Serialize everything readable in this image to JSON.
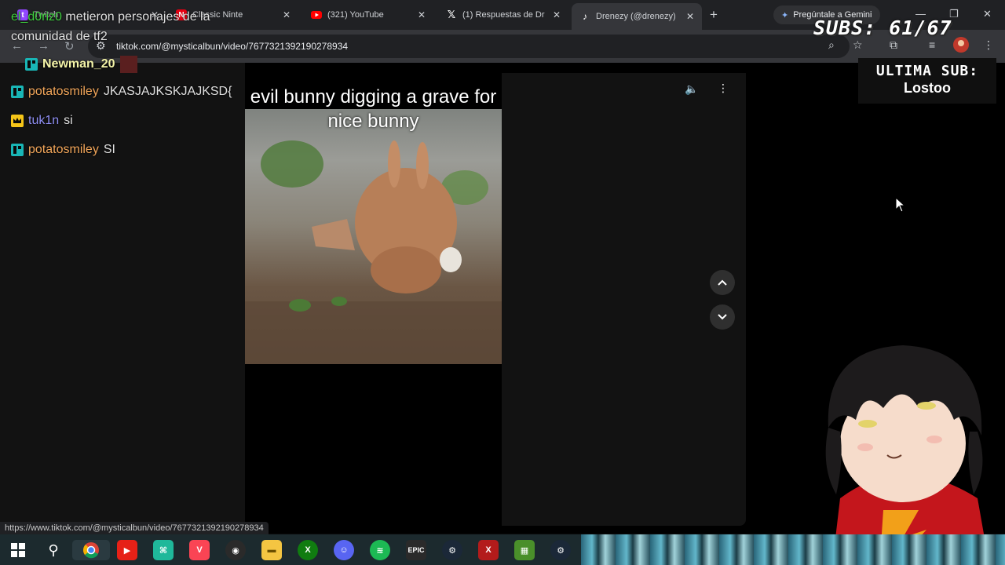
{
  "tabs": [
    {
      "label": "Twitch",
      "x_label": "✕"
    },
    {
      "label": "Classic Ninte",
      "x_label": "✕"
    },
    {
      "label": "(321) YouTube",
      "x_label": "✕"
    },
    {
      "label": "(1) Respuestas de Dr",
      "x_label": "✕"
    },
    {
      "label": "Drenezy (@drenezy)",
      "x_label": "✕"
    }
  ],
  "new_tab": "+",
  "gemini_label": "Pregúntale a Gemini",
  "address": {
    "url": "tiktok.com/@mysticalbun/video/7677321392190278934"
  },
  "chat": [
    {
      "user": "el_d0riz0",
      "message": "metieron personajes de la comunidad de tf2",
      "user_color": "#3ecf3e"
    },
    {
      "user": "Newman_20",
      "message": "",
      "user_color": "#f4f4a8"
    },
    {
      "user": "potatosmiley",
      "message": "JKASJAJKSKJAJKSD{",
      "user_color": "#f2a65a"
    },
    {
      "user": "tuk1n",
      "message": "si",
      "user_color": "#8f8ff5"
    },
    {
      "user": "potatosmiley",
      "message": "SI",
      "user_color": "#f2a65a"
    }
  ],
  "video": {
    "caption": "evil bunny digging a grave for nice bunny"
  },
  "status_url": "https://www.tiktok.com/@mysticalbun/video/7677321392190278934",
  "overlay": {
    "subs": "SUBS: 61/67",
    "ultima_heading": "ULTIMA SUB:",
    "ultima_value": "Lostoo"
  },
  "taskbar_apps": [
    "windows",
    "search",
    "chrome",
    "youtube",
    "app",
    "valorant",
    "obs",
    "files",
    "xbox",
    "discord",
    "spotify",
    "epic",
    "steam",
    "x",
    "minecraft",
    "steam"
  ]
}
